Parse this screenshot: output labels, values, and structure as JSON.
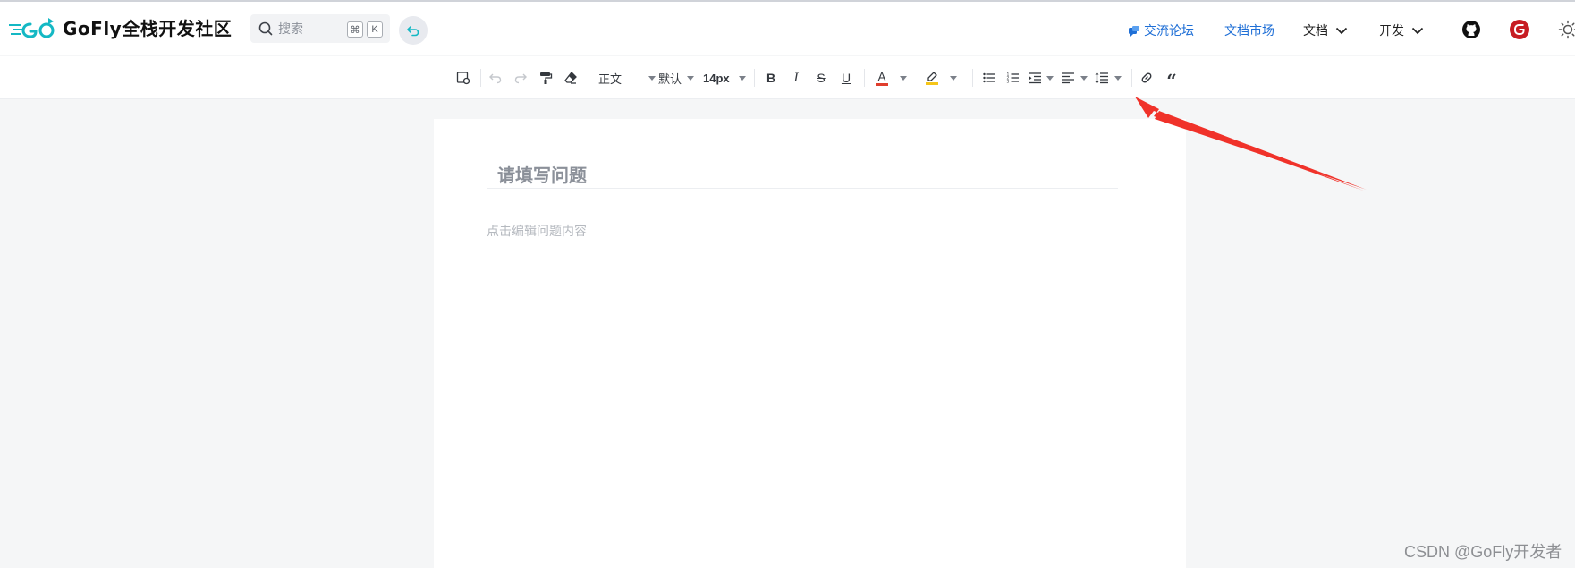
{
  "header": {
    "logo_text": "GoFly全栈开发社区",
    "search": {
      "placeholder": "搜索",
      "shortcut_key1": "⌘",
      "shortcut_key2": "K"
    },
    "nav": {
      "forum": "交流论坛",
      "docs_market": "文档市场",
      "docs": "文档",
      "dev": "开发"
    },
    "icons": [
      "github-icon",
      "gitee-icon",
      "theme-toggle-icon"
    ],
    "colors": {
      "link": "#1f6fd6",
      "gitee": "#c71d23",
      "accent": "#14b8c4"
    }
  },
  "toolbar": {
    "paragraph_style": "正文",
    "font_family": "默认",
    "font_size": "14px",
    "text_color": "#e03e2d",
    "highlight_color": "#f5c518"
  },
  "editor": {
    "title_placeholder": "请填写问题",
    "body_placeholder": "点击编辑问题内容"
  },
  "annotation": {
    "arrow_color": "#f0322a"
  },
  "watermark": "CSDN @GoFly开发者"
}
